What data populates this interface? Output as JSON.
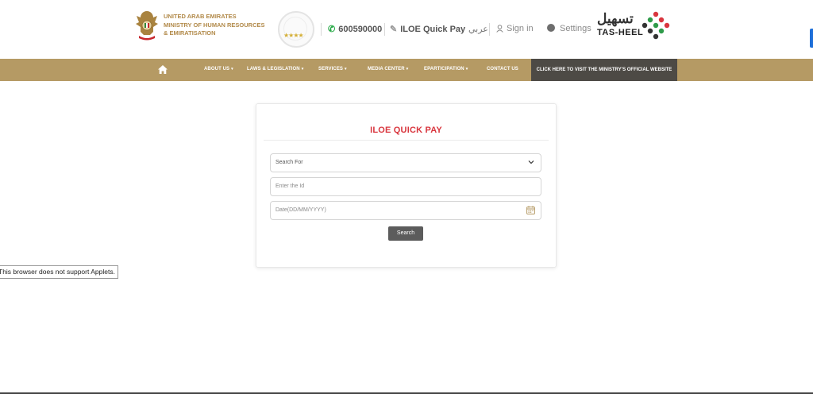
{
  "header": {
    "ministry_lines": [
      "UNITED ARAB EMIRATES",
      "MINISTRY OF HUMAN RESOURCES",
      "& EMIRATISATION"
    ],
    "phone": "600590000",
    "quick_pay": "ILOE Quick Pay",
    "arabic": "عربي",
    "sign_in": "Sign in",
    "settings": "Settings",
    "tasheel_ar": "تسهيل",
    "tasheel_en": "TAS-HEEL",
    "badge_stars": "★★★★"
  },
  "nav": {
    "items": [
      "ABOUT US",
      "LAWS & LEGISLATION",
      "SERVICES",
      "MEDIA CENTER",
      "EPARTICIPATION",
      "CONTACT US"
    ],
    "visit": "CLICK HERE TO VISIT THE MINISTRY'S OFFICIAL WEBSITE"
  },
  "form": {
    "title": "ILOE QUICK PAY",
    "search_for": "Search For",
    "id_placeholder": "Enter the Id",
    "date_placeholder": "Date(DD/MM/YYYY)",
    "search_button": "Search"
  },
  "applet_notice": "This browser does not support Applets.",
  "colors": {
    "nav_bg": "#b59a64",
    "visit_bg": "#4d4a45",
    "title_red": "#d9363e",
    "gold_text": "#b28a4a",
    "button_bg": "#5c5c5c"
  }
}
